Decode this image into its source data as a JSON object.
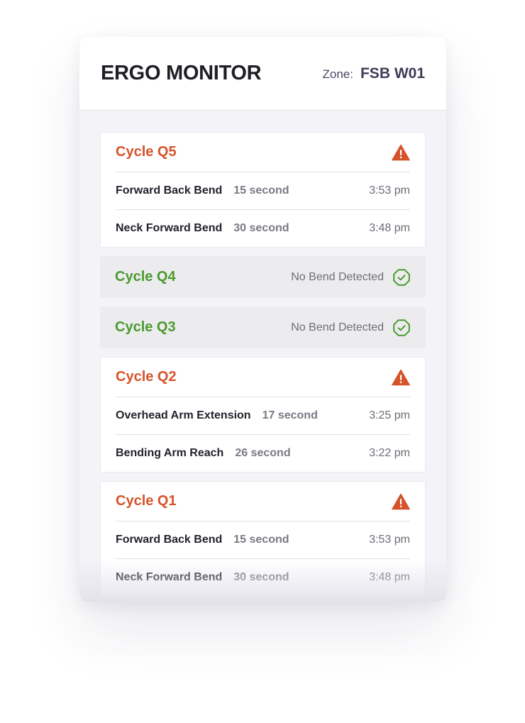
{
  "header": {
    "title": "ERGO MONITOR",
    "zone_label": "Zone:",
    "zone_value": "FSB W01"
  },
  "colors": {
    "alert": "#d6532a",
    "ok": "#4a9a2e"
  },
  "cycles": [
    {
      "title": "Cycle Q5",
      "status": "alert",
      "icon": "warning-icon",
      "events": [
        {
          "name": "Forward Back Bend",
          "duration": "15 second",
          "time": "3:53 pm"
        },
        {
          "name": "Neck Forward Bend",
          "duration": "30 second",
          "time": "3:48 pm"
        }
      ]
    },
    {
      "title": "Cycle Q4",
      "status": "ok",
      "icon": "check-octagon-icon",
      "message": "No Bend Detected"
    },
    {
      "title": "Cycle Q3",
      "status": "ok",
      "icon": "check-octagon-icon",
      "message": "No Bend Detected"
    },
    {
      "title": "Cycle Q2",
      "status": "alert",
      "icon": "warning-icon",
      "events": [
        {
          "name": "Overhead Arm Extension",
          "duration": "17 second",
          "time": "3:25 pm"
        },
        {
          "name": "Bending Arm Reach",
          "duration": "26 second",
          "time": "3:22 pm"
        }
      ]
    },
    {
      "title": "Cycle Q1",
      "status": "alert",
      "icon": "warning-icon",
      "events": [
        {
          "name": "Forward Back Bend",
          "duration": "15 second",
          "time": "3:53 pm"
        },
        {
          "name": "Neck Forward Bend",
          "duration": "30 second",
          "time": "3:48 pm"
        }
      ]
    }
  ]
}
